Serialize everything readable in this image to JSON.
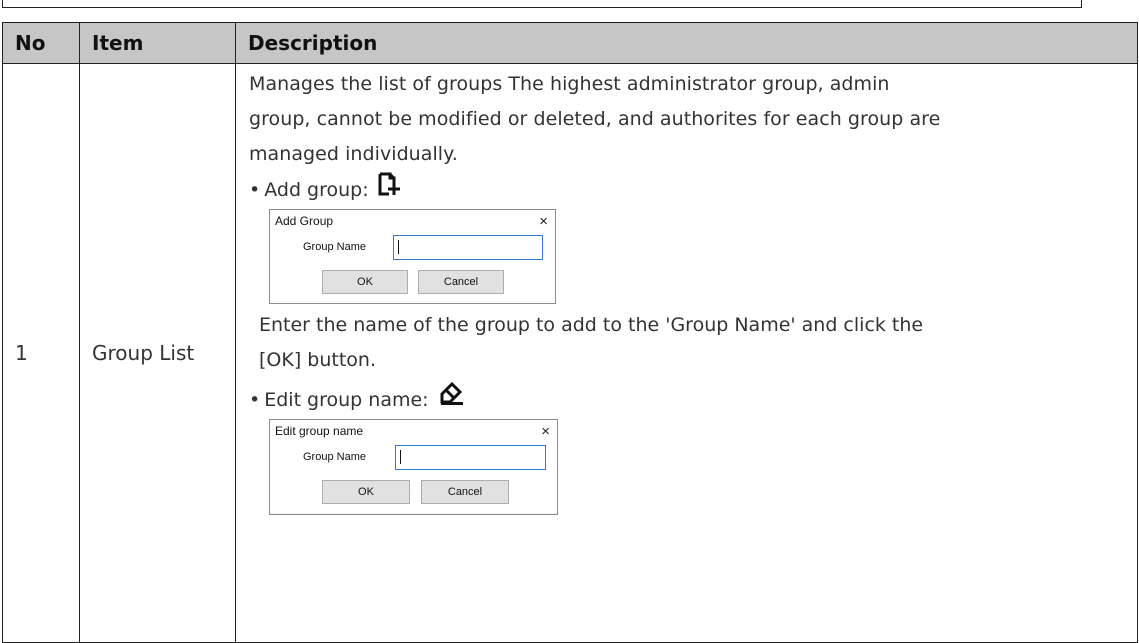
{
  "table": {
    "headers": {
      "no": "No",
      "item": "Item",
      "description": "Description"
    },
    "rows": [
      {
        "no": "1",
        "item": "Group List",
        "description": {
          "intro_lines": [
            "Manages the list of groups The highest administrator group, admin",
            "group, cannot be modified or deleted, and authorites for each group are",
            "managed individually."
          ],
          "add_group": {
            "bullet": "•",
            "label": "Add group:",
            "icon": "add-document-icon",
            "dialog": {
              "title": "Add Group",
              "close": "×",
              "field_label": "Group Name",
              "field_value": "",
              "ok_label": "OK",
              "cancel_label": "Cancel"
            },
            "instruction_lines": [
              "Enter the name of the group to add to the 'Group Name' and click the",
              "[OK] button."
            ]
          },
          "edit_group": {
            "bullet": "•",
            "label": "Edit group name:",
            "icon": "eraser-edit-icon",
            "dialog": {
              "title": "Edit group name",
              "close": "×",
              "field_label": "Group Name",
              "field_value": "",
              "ok_label": "OK",
              "cancel_label": "Cancel"
            }
          }
        }
      }
    ]
  }
}
